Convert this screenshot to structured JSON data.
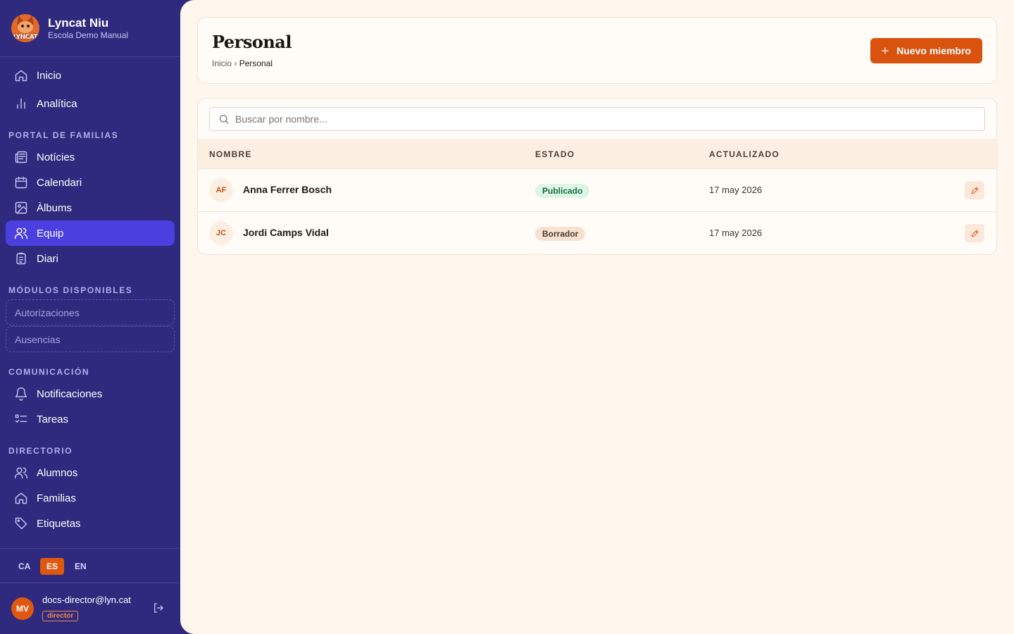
{
  "brand": {
    "name": "Lyncat Niu",
    "subtitle": "Escola Demo Manual",
    "logo_text": "LYNCAT"
  },
  "nav": {
    "top": [
      {
        "label": "Inicio",
        "icon": "home-icon"
      },
      {
        "label": "Analítica",
        "icon": "bar-chart-icon"
      }
    ],
    "portal_title": "PORTAL DE FAMILIAS",
    "portal": [
      {
        "label": "Notícies",
        "icon": "newspaper-icon"
      },
      {
        "label": "Calendari",
        "icon": "calendar-icon"
      },
      {
        "label": "Àlbums",
        "icon": "image-icon"
      },
      {
        "label": "Equip",
        "icon": "users-icon",
        "active": true
      },
      {
        "label": "Diari",
        "icon": "clipboard-icon"
      }
    ],
    "modules_title": "MÓDULOS DISPONIBLES",
    "modules": [
      "Autorizaciones",
      "Ausencias"
    ],
    "comm_title": "COMUNICACIÓN",
    "comm": [
      {
        "label": "Notificaciones",
        "icon": "bell-icon"
      },
      {
        "label": "Tareas",
        "icon": "checklist-icon"
      }
    ],
    "dir_title": "DIRECTORIO",
    "dir": [
      {
        "label": "Alumnos",
        "icon": "users-icon"
      },
      {
        "label": "Familias",
        "icon": "home-icon"
      },
      {
        "label": "Etiquetas",
        "icon": "tag-icon"
      }
    ]
  },
  "languages": [
    "CA",
    "ES",
    "EN"
  ],
  "active_language": "ES",
  "user": {
    "initials": "MV",
    "email": "docs-director@lyn.cat",
    "role": "director"
  },
  "page": {
    "title": "Personal",
    "breadcrumb": {
      "home": "Inicio",
      "separator": "›",
      "current": "Personal"
    },
    "new_button": "Nuevo miembro",
    "search_placeholder": "Buscar por nombre...",
    "columns": {
      "name": "NOMBRE",
      "status": "ESTADO",
      "updated": "ACTUALIZADO"
    },
    "rows": [
      {
        "initials": "AF",
        "name": "Anna Ferrer Bosch",
        "status": "Publicado",
        "status_kind": "published",
        "updated": "17 may 2026"
      },
      {
        "initials": "JC",
        "name": "Jordi Camps Vidal",
        "status": "Borrador",
        "status_kind": "draft",
        "updated": "17 may 2026"
      }
    ]
  },
  "colors": {
    "sidebar": "#2f2a7d",
    "active_nav": "#4b3fe0",
    "accent": "#d9530f",
    "background": "#fff6ee"
  }
}
